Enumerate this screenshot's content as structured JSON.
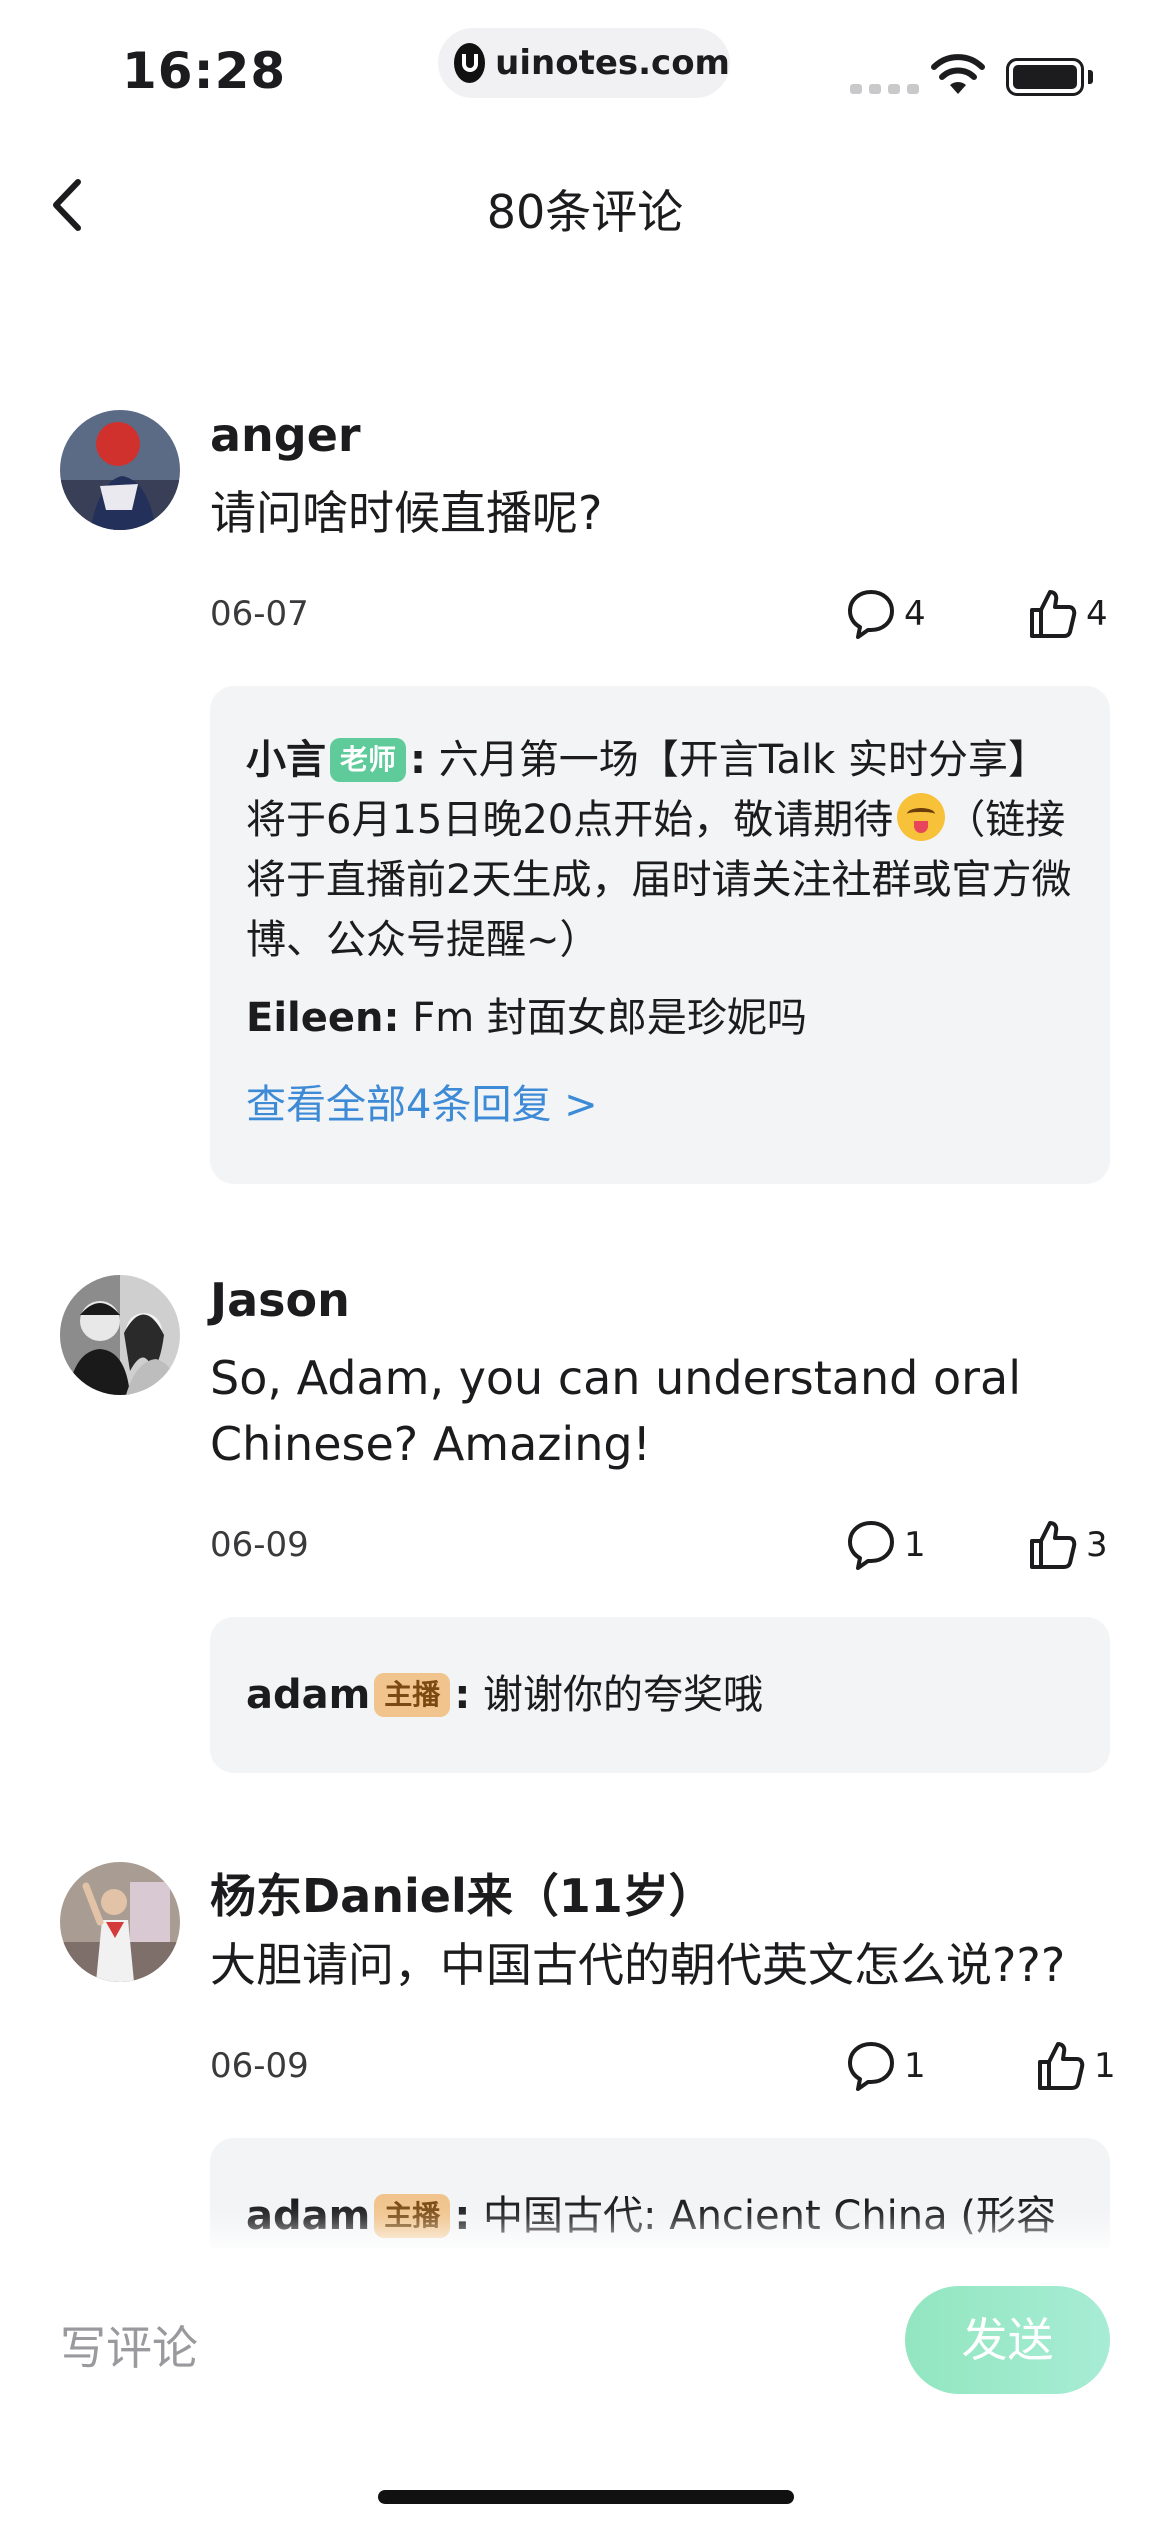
{
  "status_bar": {
    "time": "16:28",
    "url": "uinotes.com"
  },
  "header": {
    "title": "80条评论",
    "back_icon": "chevron-left-icon"
  },
  "comments": [
    {
      "author": "anger",
      "text": "请问啥时候直播呢?",
      "date": "06-07",
      "reply_count": "4",
      "like_count": "4",
      "replies": [
        {
          "author": "小言",
          "badge": "老师",
          "separator": ":",
          "text": "六月第一场【开言Talk 实时分享】将于6月15日晚20点开始，敬请期待",
          "text_after_emoji": "（链接将于直播前2天生成，届时请关注社群或官方微博、公众号提醒~）",
          "emoji": "squinting-tongue-emoji"
        },
        {
          "author": "Eileen:",
          "text": "Fm 封面女郎是珍妮吗"
        }
      ],
      "view_all": "查看全部4条回复 >"
    },
    {
      "author": "Jason",
      "text": "So, Adam, you can understand oral Chinese? Amazing!",
      "date": "06-09",
      "reply_count": "1",
      "like_count": "3",
      "replies": [
        {
          "author": "adam",
          "badge": "主播",
          "separator": ":",
          "text": "谢谢你的夸奖哦"
        }
      ]
    },
    {
      "author": "杨东Daniel来（11岁）",
      "text": "大胆请问，中国古代的朝代英文怎么说???",
      "date": "06-09",
      "reply_count": "1",
      "like_count": "1",
      "replies": [
        {
          "author": "adam",
          "badge": "主播",
          "separator": ":",
          "text": "中国古代: Ancient China (形容"
        }
      ]
    }
  ],
  "composer": {
    "placeholder": "写评论",
    "send_label": "发送"
  },
  "colors": {
    "teacher_badge": "#5fcb9b",
    "host_badge": "#f0c48c",
    "link": "#3d8ad6",
    "send_button": "#92e6c0",
    "reply_bg": "#f3f4f6"
  }
}
